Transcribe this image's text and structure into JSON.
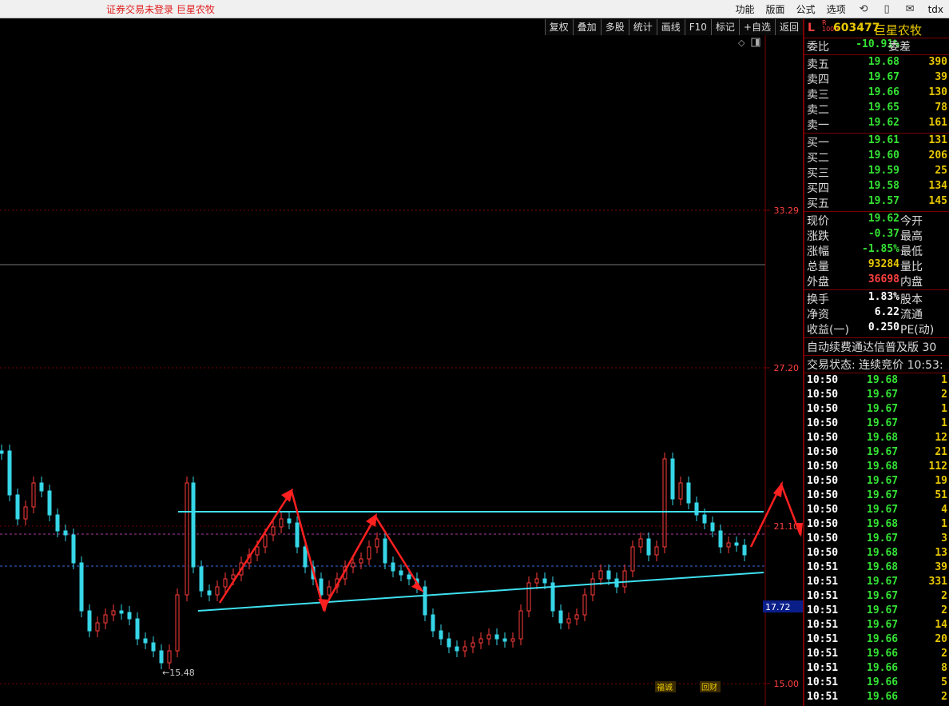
{
  "titlebar": {
    "status_text": "证券交易未登录   巨星农牧",
    "menu": [
      "功能",
      "版面",
      "公式",
      "选项"
    ],
    "icons": [
      "refresh-icon",
      "phone-icon",
      "mail-icon"
    ],
    "user": "tdx"
  },
  "toolbar": [
    "复权",
    "叠加",
    "多股",
    "统计",
    "画线",
    "F10",
    "标记",
    "+自选",
    "返回"
  ],
  "chart": {
    "price_labels": [
      "33.29",
      "27.20",
      "21.10",
      "15.00"
    ],
    "current_price_tag": "17.72",
    "low_label": "15.48",
    "corner_tags": [
      "福诚",
      "回财"
    ],
    "colors": {
      "up": "#ff3b3b",
      "down": "#36d6e7",
      "grid": "#7a0000",
      "trendline": "#3fe0f0",
      "arrow": "#ff2020"
    }
  },
  "quote": {
    "flag": "L",
    "flag_r": "R",
    "flag_sub": "1000",
    "code": "603477",
    "name": "巨星农牧",
    "weibi_label": "委比",
    "weibi": "-10.91%",
    "weicha_label": "委差",
    "asks": [
      {
        "label": "卖五",
        "price": "19.68",
        "vol": "390"
      },
      {
        "label": "卖四",
        "price": "19.67",
        "vol": "39"
      },
      {
        "label": "卖三",
        "price": "19.66",
        "vol": "130"
      },
      {
        "label": "卖二",
        "price": "19.65",
        "vol": "78"
      },
      {
        "label": "卖一",
        "price": "19.62",
        "vol": "161"
      }
    ],
    "bids": [
      {
        "label": "买一",
        "price": "19.61",
        "vol": "131"
      },
      {
        "label": "买二",
        "price": "19.60",
        "vol": "206"
      },
      {
        "label": "买三",
        "price": "19.59",
        "vol": "25"
      },
      {
        "label": "买四",
        "price": "19.58",
        "vol": "134"
      },
      {
        "label": "买五",
        "price": "19.57",
        "vol": "145"
      }
    ],
    "stats1": [
      {
        "label": "现价",
        "value": "19.62",
        "cls": "green",
        "label2": "今开"
      },
      {
        "label": "涨跌",
        "value": "-0.37",
        "cls": "green",
        "label2": "最高"
      },
      {
        "label": "涨幅",
        "value": "-1.85%",
        "cls": "green",
        "label2": "最低"
      },
      {
        "label": "总量",
        "value": "93284",
        "cls": "yellow",
        "label2": "量比"
      },
      {
        "label": "外盘",
        "value": "36698",
        "cls": "red",
        "label2": "内盘"
      }
    ],
    "stats2": [
      {
        "label": "换手",
        "value": "1.83%",
        "cls": "white",
        "label2": "股本"
      },
      {
        "label": "净资",
        "value": "6.22",
        "cls": "white",
        "label2": "流通"
      },
      {
        "label": "收益(一)",
        "value": "0.250",
        "cls": "white",
        "label2": "PE(动)"
      }
    ],
    "notice": "自动续费通达信普及版 30",
    "trade_status": "交易状态: 连续竞价 10:53:"
  },
  "trades": [
    {
      "t": "10:50",
      "p": "19.68",
      "v": "1"
    },
    {
      "t": "10:50",
      "p": "19.67",
      "v": "2"
    },
    {
      "t": "10:50",
      "p": "19.67",
      "v": "1"
    },
    {
      "t": "10:50",
      "p": "19.67",
      "v": "1"
    },
    {
      "t": "10:50",
      "p": "19.68",
      "v": "12"
    },
    {
      "t": "10:50",
      "p": "19.67",
      "v": "21"
    },
    {
      "t": "10:50",
      "p": "19.68",
      "v": "112"
    },
    {
      "t": "10:50",
      "p": "19.67",
      "v": "19"
    },
    {
      "t": "10:50",
      "p": "19.67",
      "v": "51"
    },
    {
      "t": "10:50",
      "p": "19.67",
      "v": "4"
    },
    {
      "t": "10:50",
      "p": "19.68",
      "v": "1"
    },
    {
      "t": "10:50",
      "p": "19.67",
      "v": "3"
    },
    {
      "t": "10:50",
      "p": "19.68",
      "v": "13"
    },
    {
      "t": "10:51",
      "p": "19.68",
      "v": "39"
    },
    {
      "t": "10:51",
      "p": "19.67",
      "v": "331"
    },
    {
      "t": "10:51",
      "p": "19.67",
      "v": "2"
    },
    {
      "t": "10:51",
      "p": "19.67",
      "v": "2"
    },
    {
      "t": "10:51",
      "p": "19.67",
      "v": "14"
    },
    {
      "t": "10:51",
      "p": "19.66",
      "v": "20"
    },
    {
      "t": "10:51",
      "p": "19.66",
      "v": "2"
    },
    {
      "t": "10:51",
      "p": "19.66",
      "v": "8"
    },
    {
      "t": "10:51",
      "p": "19.66",
      "v": "5"
    },
    {
      "t": "10:51",
      "p": "19.66",
      "v": "2"
    }
  ]
}
